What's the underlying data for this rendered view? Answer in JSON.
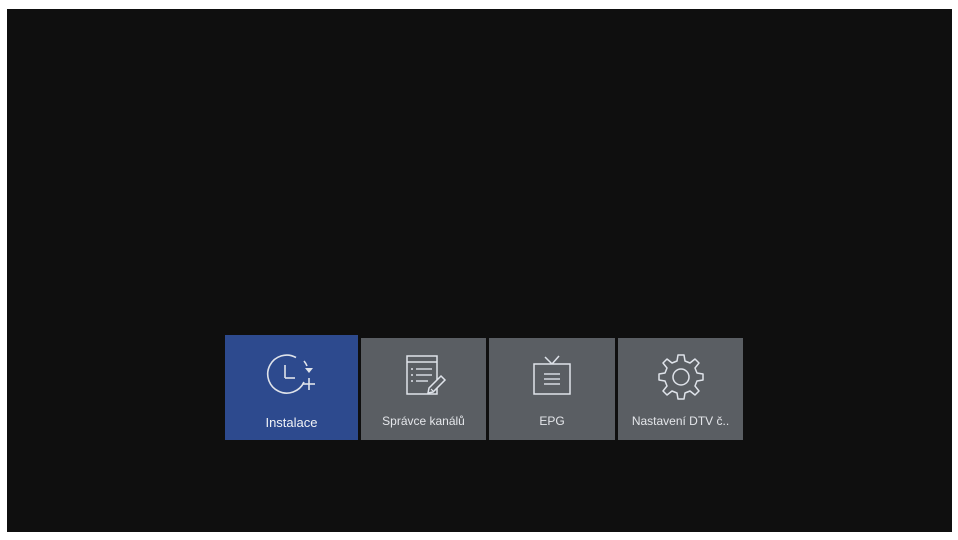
{
  "menu": {
    "items": [
      {
        "label": "Instalace",
        "icon": "clock-add-icon",
        "selected": true
      },
      {
        "label": "Správce kanálů",
        "icon": "list-edit-icon",
        "selected": false
      },
      {
        "label": "EPG",
        "icon": "tv-guide-icon",
        "selected": false
      },
      {
        "label": "Nastavení DTV č..",
        "icon": "gear-icon",
        "selected": false
      }
    ]
  },
  "colors": {
    "screen_background": "#0f0f0f",
    "tile_background": "#5a5e63",
    "tile_selected": "#2d4a8e",
    "label_text": "#e4e6ea"
  }
}
